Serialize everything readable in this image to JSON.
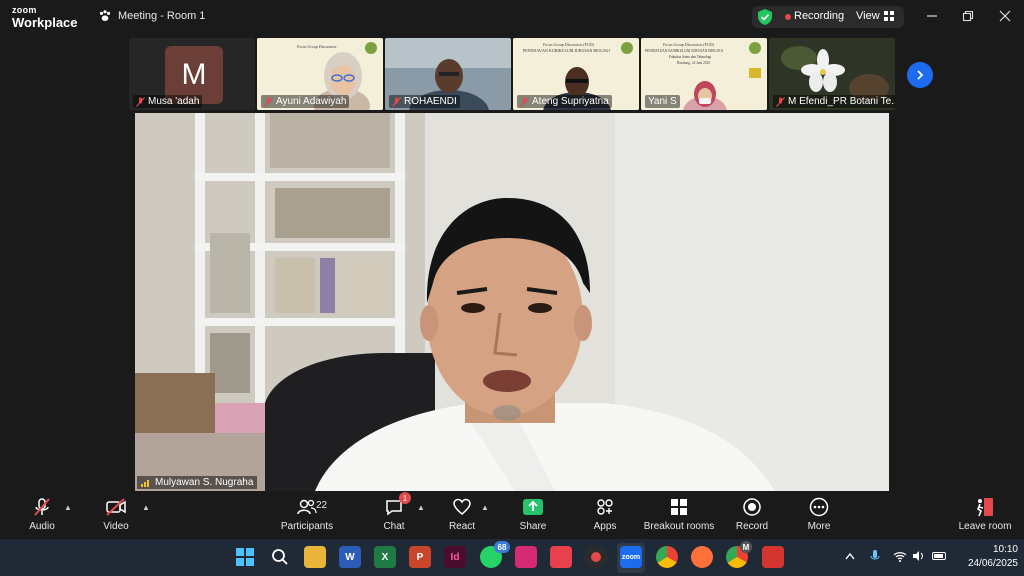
{
  "app": {
    "brand_top": "zoom",
    "brand_bottom": "Workplace",
    "meeting_title": "Meeting - Room 1"
  },
  "status": {
    "recording_label": "Recording",
    "view_label": "View"
  },
  "participants_strip": [
    {
      "name": "Musa 'adah",
      "initial": "M"
    },
    {
      "name": "Ayuni Adawiyah"
    },
    {
      "name": "ROHAENDI"
    },
    {
      "name": "Ateng Supriyatna"
    },
    {
      "name": "Yani S"
    },
    {
      "name": "M Efendi_PR Botani Te..."
    }
  ],
  "slide_text": {
    "line1": "Focus Group Discussion (FGD)",
    "line2": "PENINJAUAN KURIKULUM JURUSAN BIOLOGI",
    "line3": "Fakultas Sains dan Teknologi",
    "line4": "Bandung, 24 Juni 2025"
  },
  "main_speaker": {
    "name": "Mulyawan S. Nugraha"
  },
  "toolbar": {
    "audio": "Audio",
    "video": "Video",
    "participants": "Participants",
    "participants_count": "22",
    "chat": "Chat",
    "chat_badge": "1",
    "react": "React",
    "share": "Share",
    "apps": "Apps",
    "breakout": "Breakout rooms",
    "record": "Record",
    "more": "More",
    "leave": "Leave room"
  },
  "taskbar": {
    "whatsapp_badge": "68",
    "word_letter": "W",
    "excel_letter": "X",
    "ppt_letter": "P",
    "indesign_letter": "Id",
    "zoom_label": "zoom",
    "chrome_profile_letter": "M"
  },
  "clock": {
    "time": "10:10",
    "date": "24/06/2025"
  },
  "colors": {
    "accent_blue": "#1d6cf0",
    "recording_red": "#e5484d",
    "shield_green": "#22c55e",
    "share_green": "#27c26c"
  }
}
